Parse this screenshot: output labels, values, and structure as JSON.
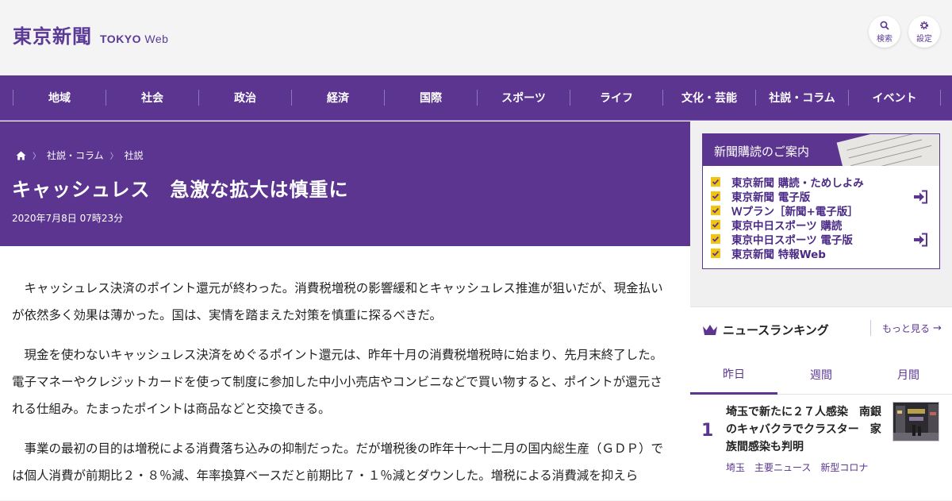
{
  "header": {
    "logo_jp": "東京新聞",
    "logo_en_bold": "TOKYO",
    "logo_en_light": "Web",
    "search_label": "検索",
    "settings_label": "設定"
  },
  "nav": {
    "items": [
      "地域",
      "社会",
      "政治",
      "経済",
      "国際",
      "スポーツ",
      "ライフ",
      "文化・芸能",
      "社説・コラム",
      "イベント"
    ]
  },
  "article": {
    "breadcrumbs": [
      "社説・コラム",
      "社説"
    ],
    "title": "キャッシュレス　急激な拡大は慎重に",
    "date": "2020年7月8日 07時23分",
    "paragraphs": [
      "キャッシュレス決済のポイント還元が終わった。消費税増税の影響緩和とキャッシュレス推進が狙いだが、現金払いが依然多く効果は薄かった。国は、実情を踏まえた対策を慎重に探るべきだ。",
      "現金を使わないキャッシュレス決済をめぐるポイント還元は、昨年十月の消費税増税時に始まり、先月末終了した。電子マネーやクレジットカードを使って制度に参加した中小小売店やコンビニなどで買い物すると、ポイントが還元される仕組み。たまったポイントは商品などと交換できる。",
      "事業の最初の目的は増税による消費落ち込みの抑制だった。だが増税後の昨年十〜十二月の国内総生産（ＧＤＰ）では個人消費が前期比２・８％減、年率換算ベースだと前期比７・１％減とダウンした。増税による消費減を抑えら"
    ]
  },
  "sidebar": {
    "promo": {
      "title": "新聞購読のご案内",
      "links": [
        "東京新聞 購読・ためしよみ",
        "東京新聞 電子版",
        "Ｗプラン［新聞+電子版］",
        "東京中日スポーツ 購読",
        "東京中日スポーツ 電子版",
        "東京新聞 特報Web"
      ]
    },
    "ranking": {
      "title": "ニュースランキング",
      "more": "もっと見る",
      "tabs": [
        "昨日",
        "週間",
        "月間"
      ],
      "active_tab": "昨日",
      "items": [
        {
          "rank": "1",
          "headline": "埼玉で新たに２７人感染　南銀のキャバクラでクラスター　家族間感染も判明",
          "tags": [
            "埼玉",
            "主要ニュース",
            "新型コロナ"
          ]
        }
      ]
    }
  },
  "colors": {
    "brand_purple": "#5b3590",
    "check_yellow": "#f1c40f"
  }
}
